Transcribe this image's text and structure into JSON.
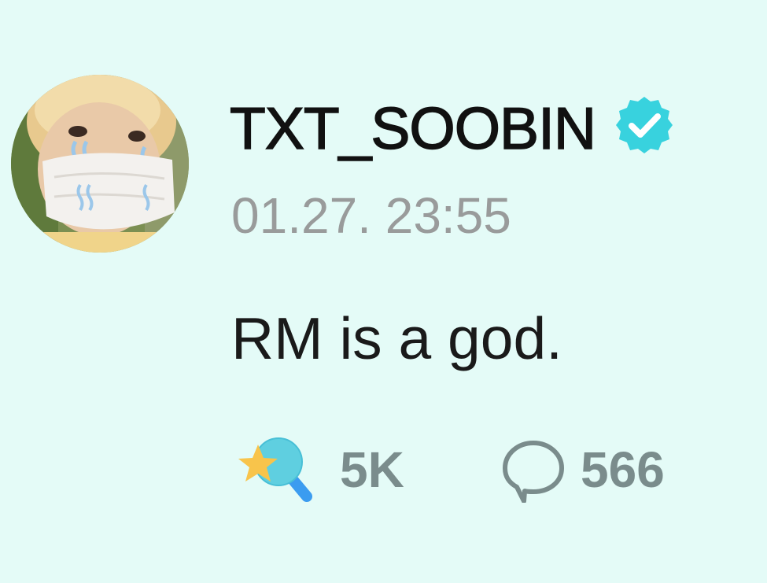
{
  "post": {
    "author": {
      "username": "TXT_SOOBIN",
      "verified": true,
      "avatar_icon": "profile-photo-masked"
    },
    "timestamp": "01.27. 23:55",
    "content": "RM is a god.",
    "stats": {
      "likes": {
        "icon": "star-search-icon",
        "count": "5K"
      },
      "comments": {
        "icon": "speech-bubble-icon",
        "count": "566"
      }
    }
  },
  "colors": {
    "background": "#e4fbf7",
    "username": "#111111",
    "timestamp": "#999b9b",
    "verified_badge": "#38d2de",
    "stat_text": "#7a8c8c",
    "star": "#f8c44b",
    "like_blue": "#3b9cf0"
  }
}
